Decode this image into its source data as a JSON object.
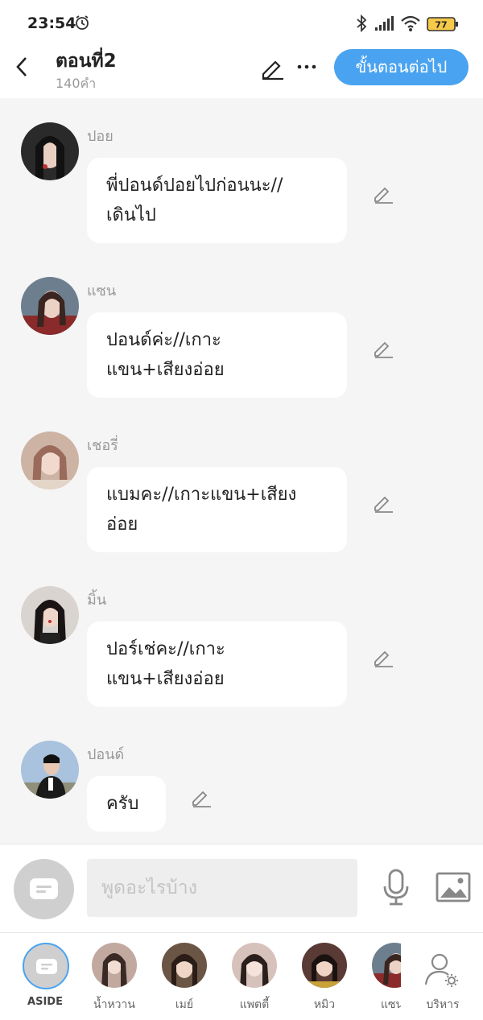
{
  "status_bar": {
    "time": "23:54",
    "battery": "77",
    "icons": [
      "alarm-icon",
      "bluetooth-icon",
      "signal-icon",
      "wifi-icon",
      "battery-icon"
    ]
  },
  "header": {
    "title": "ตอนที่2",
    "subtitle": "140คำ",
    "next_label": "ขั้นตอนต่อไป",
    "icons": [
      "back-icon",
      "edit-title-icon",
      "more-icon"
    ]
  },
  "messages": [
    {
      "sender": "ปอย",
      "text_lines": [
        "พี่ปอนด์ปอยไปก่อนนะ//",
        "เดินไป"
      ],
      "avatar_color": "#2a2a2a"
    },
    {
      "sender": "แซน",
      "text_lines": [
        "ปอนด์ค่ะ//เกาะ",
        "แขน+เสียงอ่อย"
      ],
      "avatar_color": "#8a3a3a"
    },
    {
      "sender": "เชอรี่",
      "text_lines": [
        "แบมคะ//เกาะแขน+เสียง",
        "อ่อย"
      ],
      "avatar_color": "#c7a090"
    },
    {
      "sender": "มิ้น",
      "text_lines": [
        "ปอร์เช่คะ//เกาะ",
        "แขน+เสียงอ่อย"
      ],
      "avatar_color": "#3a3030"
    },
    {
      "sender": "ปอนด์",
      "text_lines": [
        "ครับ"
      ],
      "avatar_color": "#6a7d95"
    }
  ],
  "composer": {
    "placeholder": "พูดอะไรบ้าง",
    "icons": [
      "aside-toggle-icon",
      "mic-icon",
      "image-icon"
    ]
  },
  "bottom_bar": {
    "aside_label": "ASIDE",
    "characters": [
      {
        "label": "น้ำหวาน",
        "color": "#c2a9a0"
      },
      {
        "label": "เมย์",
        "color": "#6b5545"
      },
      {
        "label": "แพตตี้",
        "color": "#d7c2bb"
      },
      {
        "label": "หมิว",
        "color": "#5a3a35"
      },
      {
        "label": "แซน",
        "color": "#8a3a3a"
      }
    ],
    "manage_label": "บริหาร"
  },
  "colors": {
    "accent": "#4aa3f0",
    "background": "#f5f5f5",
    "bubble": "#ffffff"
  }
}
